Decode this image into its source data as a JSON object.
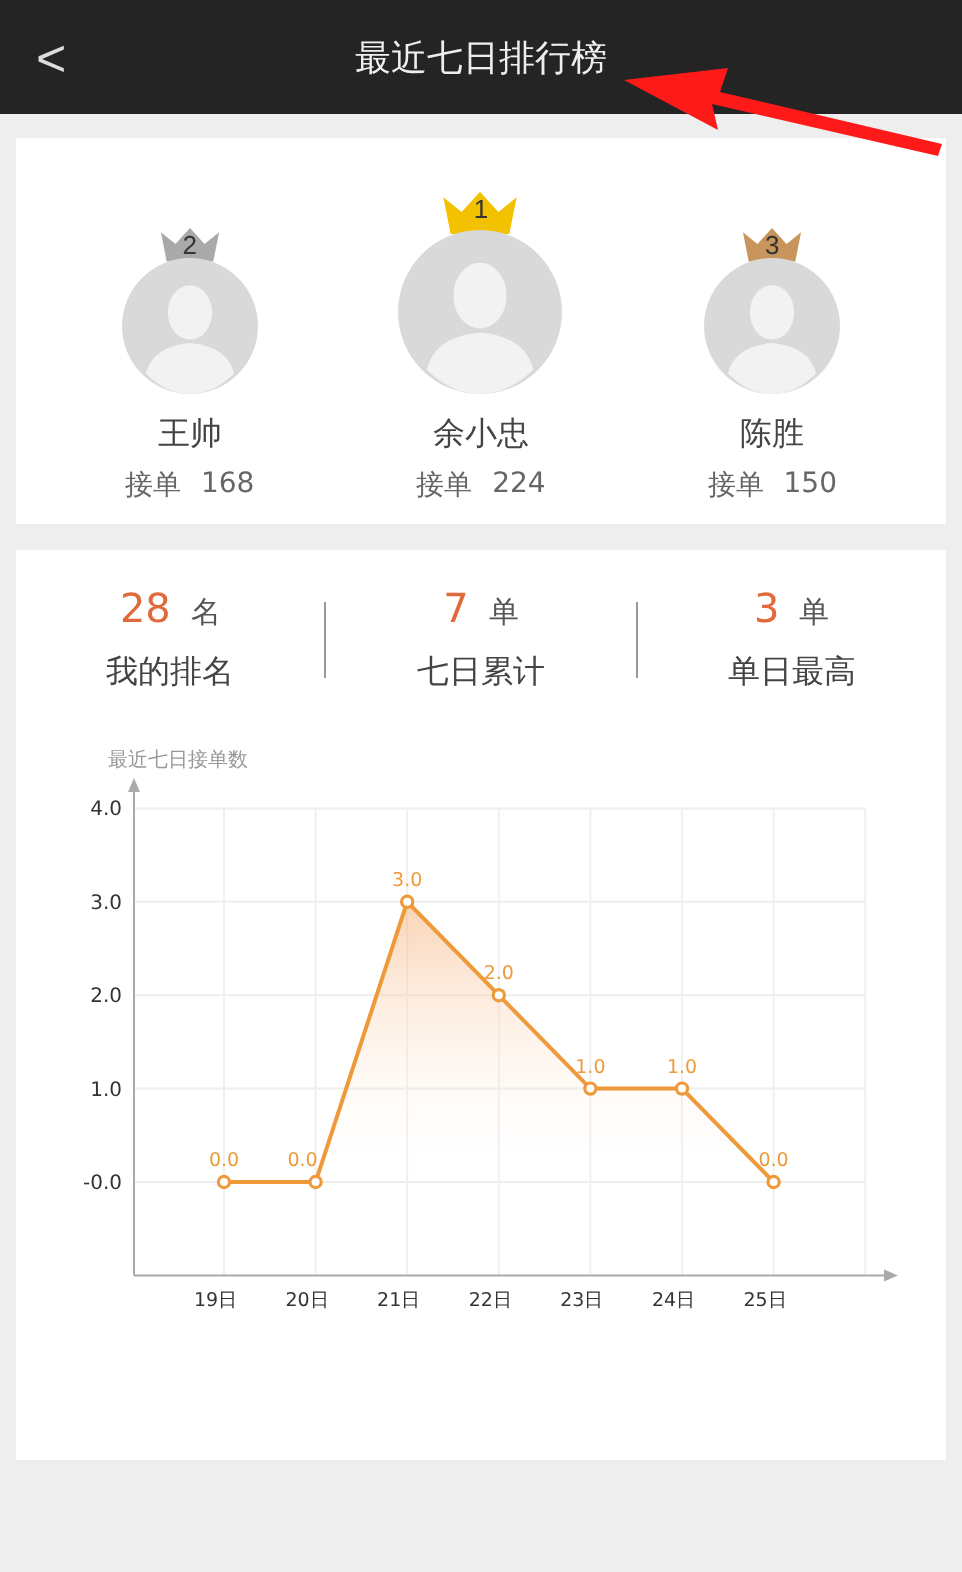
{
  "header": {
    "back": "<",
    "title": "最近七日排行榜"
  },
  "podium": [
    {
      "rank": "2",
      "name": "王帅",
      "label": "接单",
      "count": "168",
      "color": "#a9a9a9"
    },
    {
      "rank": "1",
      "name": "余小忠",
      "label": "接单",
      "count": "224",
      "color": "#f2c200"
    },
    {
      "rank": "3",
      "name": "陈胜",
      "label": "接单",
      "count": "150",
      "color": "#c8965c"
    }
  ],
  "stats": [
    {
      "value": "28",
      "unit": "名",
      "label": "我的排名"
    },
    {
      "value": "7",
      "unit": "单",
      "label": "七日累计"
    },
    {
      "value": "3",
      "unit": "单",
      "label": "单日最高"
    }
  ],
  "chart": {
    "chart_data": {
      "type": "line",
      "title": "最近七日接单数",
      "categories": [
        "19日",
        "20日",
        "21日",
        "22日",
        "23日",
        "24日",
        "25日"
      ],
      "series": [
        {
          "color": "#ee9a3a",
          "marker": "circle",
          "values": [
            0,
            0,
            3,
            2,
            1,
            1,
            0
          ]
        }
      ],
      "grid": true,
      "ylim": [
        -1,
        4
      ],
      "yticks": [
        {
          "value": 0,
          "label": "-0.0"
        },
        {
          "value": 1,
          "label": "1.0"
        },
        {
          "value": 2,
          "label": "2.0"
        },
        {
          "value": 3,
          "label": "3.0"
        },
        {
          "value": 4,
          "label": "4.0"
        }
      ],
      "value_labels": [
        "0.0",
        "0.0",
        "3.0",
        "2.0",
        "1.0",
        "1.0",
        "0.0"
      ]
    }
  }
}
